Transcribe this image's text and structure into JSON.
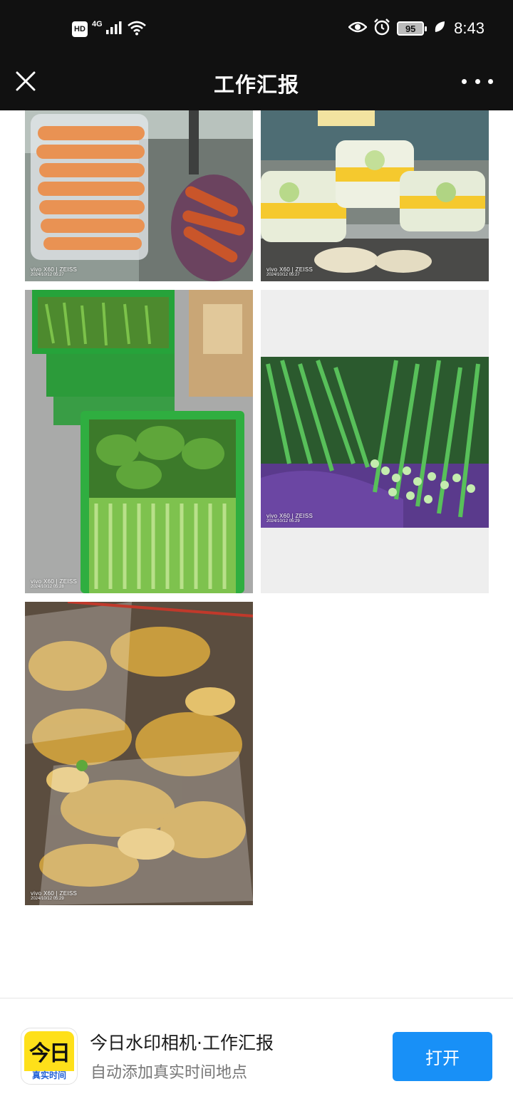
{
  "status_bar": {
    "hd_label": "HD",
    "network_label": "4G",
    "battery_level": "95",
    "time": "8:43",
    "icons": [
      "hd-icon",
      "signal-icon",
      "wifi-icon",
      "eye-icon",
      "alarm-icon",
      "battery-icon",
      "leaf-icon"
    ]
  },
  "header": {
    "title": "工作汇报",
    "close_icon": "close-icon",
    "more_icon": "more-dots-icon",
    "background": "#111111"
  },
  "photos": [
    {
      "subject": "carrots",
      "watermark_brand": "vivo X60 | ZEISS",
      "watermark_date": "2024/10/12 05:27"
    },
    {
      "subject": "wrapped vegetables",
      "watermark_brand": "vivo X60 | ZEISS",
      "watermark_date": "2024/10/12 05:27"
    },
    {
      "subject": "green vegetables in crates",
      "watermark_brand": "vivo X60 | ZEISS",
      "watermark_date": "2024/10/12 05:28"
    },
    {
      "subject": "scallions",
      "watermark_brand": "vivo X60 | ZEISS",
      "watermark_date": "2024/10/12 05:29"
    },
    {
      "subject": "ginger",
      "watermark_brand": "vivo X60 | ZEISS",
      "watermark_date": "2024/10/12 05:29"
    }
  ],
  "banner": {
    "app_icon_logo": "今日",
    "app_icon_caption": "真实时间",
    "title": "今日水印相机·工作汇报",
    "subtitle": "自动添加真实时间地点",
    "open_button": "打开",
    "button_color": "#1890f7",
    "icon_color": "#fee01a"
  }
}
